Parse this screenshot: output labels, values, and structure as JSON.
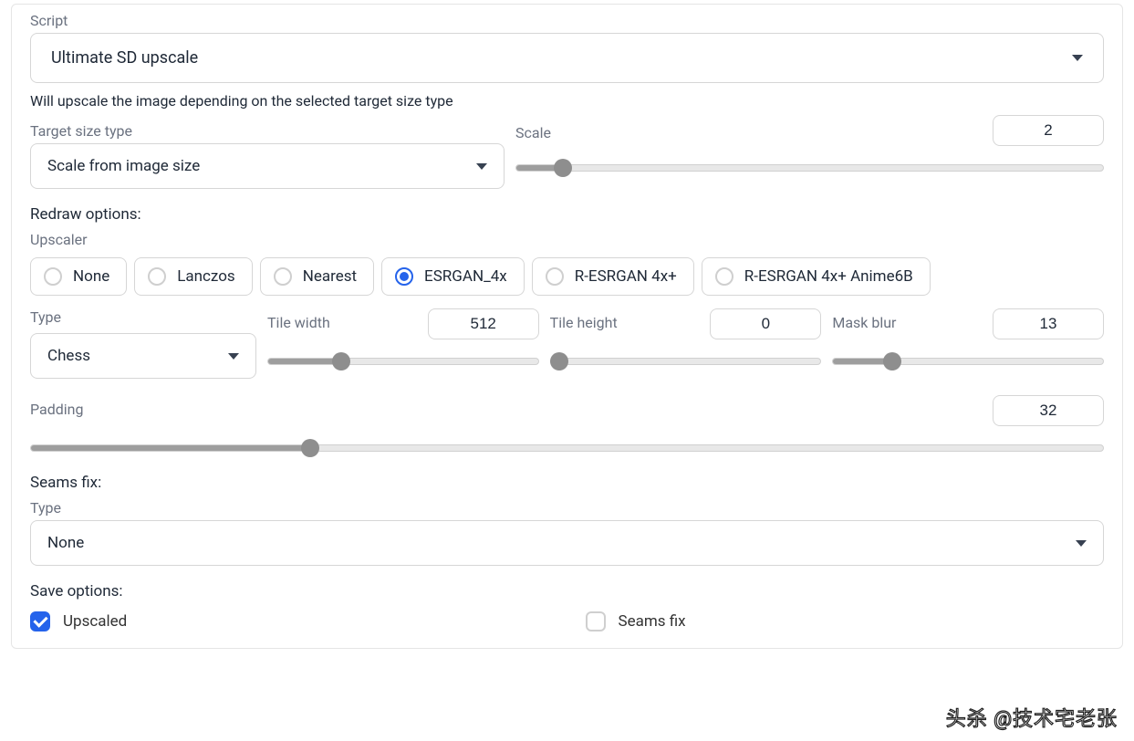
{
  "script": {
    "label": "Script",
    "selected": "Ultimate SD upscale"
  },
  "description": "Will upscale the image depending on the selected target size type",
  "target_size": {
    "label": "Target size type",
    "selected": "Scale from image size"
  },
  "scale": {
    "label": "Scale",
    "value": "2",
    "pct": 8
  },
  "redraw_label": "Redraw options:",
  "upscaler": {
    "label": "Upscaler",
    "options": [
      "None",
      "Lanczos",
      "Nearest",
      "ESRGAN_4x",
      "R-ESRGAN 4x+",
      "R-ESRGAN 4x+ Anime6B"
    ],
    "selected": "ESRGAN_4x"
  },
  "type": {
    "label": "Type",
    "selected": "Chess"
  },
  "tile_width": {
    "label": "Tile width",
    "value": "512",
    "pct": 27
  },
  "tile_height": {
    "label": "Tile height",
    "value": "0",
    "pct": 3
  },
  "mask_blur": {
    "label": "Mask blur",
    "value": "13",
    "pct": 22
  },
  "padding": {
    "label": "Padding",
    "value": "32",
    "pct": 26
  },
  "seams_fix": {
    "heading": "Seams fix:",
    "type_label": "Type",
    "type_selected": "None"
  },
  "save": {
    "heading": "Save options:",
    "upscaled_label": "Upscaled",
    "upscaled_checked": true,
    "seamsfix_label": "Seams fix",
    "seamsfix_checked": false
  },
  "watermark": "头杀 @技术宅老张"
}
